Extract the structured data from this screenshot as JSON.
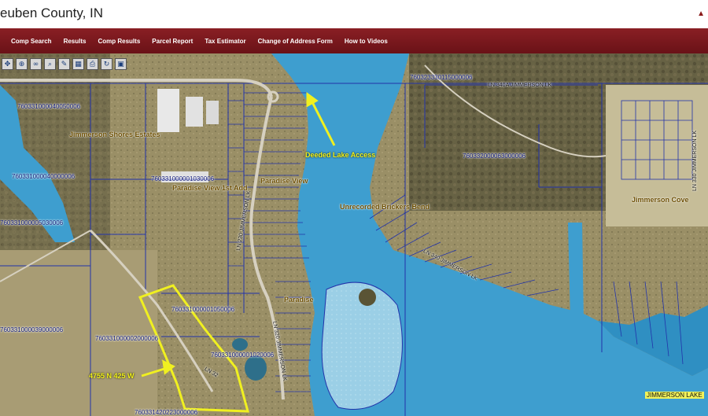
{
  "header": {
    "title": "euben County, IN"
  },
  "nav": {
    "items": [
      "Comp Search",
      "Results",
      "Comp Results",
      "Parcel Report",
      "Tax Estimator",
      "Change of Address Form",
      "How to Videos"
    ]
  },
  "toolbar": {
    "tools": [
      "pan-icon",
      "zoom-in-icon",
      "binoculars-icon",
      "magnifier-icon",
      "draw-icon",
      "measure-icon",
      "print-icon",
      "refresh-icon",
      "save-icon"
    ]
  },
  "map": {
    "parcel_ids": {
      "p1": "760323330115000006",
      "p2": "760331000040050006",
      "p3": "760331000040000006",
      "p4": "760331000001030006",
      "p5": "760331000005030006",
      "p6": "760332000063000006",
      "p7": "760331000001050006",
      "p8": "760331000039000006",
      "p9": "760331000002000006",
      "p10": "760331000001020006",
      "p11": "760331420223000006"
    },
    "subdivisions": {
      "jimmerson_shores": "Jimmerson Shores Estates",
      "paradise_view_1st": "Paradise View 1st Add",
      "paradise_view": "Paradise View",
      "bricker_bend": "Unrecorded Brickers Bend",
      "jimmerson_cove": "Jimmerson Cove",
      "paradise": "Paradise"
    },
    "roads": {
      "r1": "LN 340A JIMMERSON LK",
      "r2": "LN 340 JIMMERSON LK",
      "r3": "LN 230 JIMMERSON LK",
      "r4": "LN 330 JIMMERSON LK",
      "r5": "LN 320 JIMMERSON LK",
      "r6": "LN 32"
    },
    "annotations": {
      "deeded_access": "Deeded Lake Access",
      "address": "4755 N 425 W"
    },
    "lake_label": "JIMMERSON LAKE",
    "colors": {
      "water": "#3e9ecf",
      "parcel_line": "#2233aa",
      "highlight": "#f0f020"
    }
  }
}
